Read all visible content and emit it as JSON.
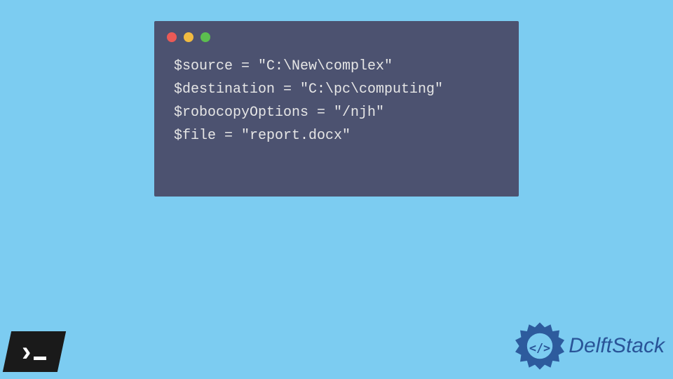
{
  "code": {
    "line1": "$source = \"C:\\New\\complex\"",
    "line2": "$destination = \"C:\\pc\\computing\"",
    "line3": "$robocopyOptions = \"/njh\"",
    "line4": "$file = \"report.docx\""
  },
  "brand": {
    "name": "DelftStack"
  }
}
